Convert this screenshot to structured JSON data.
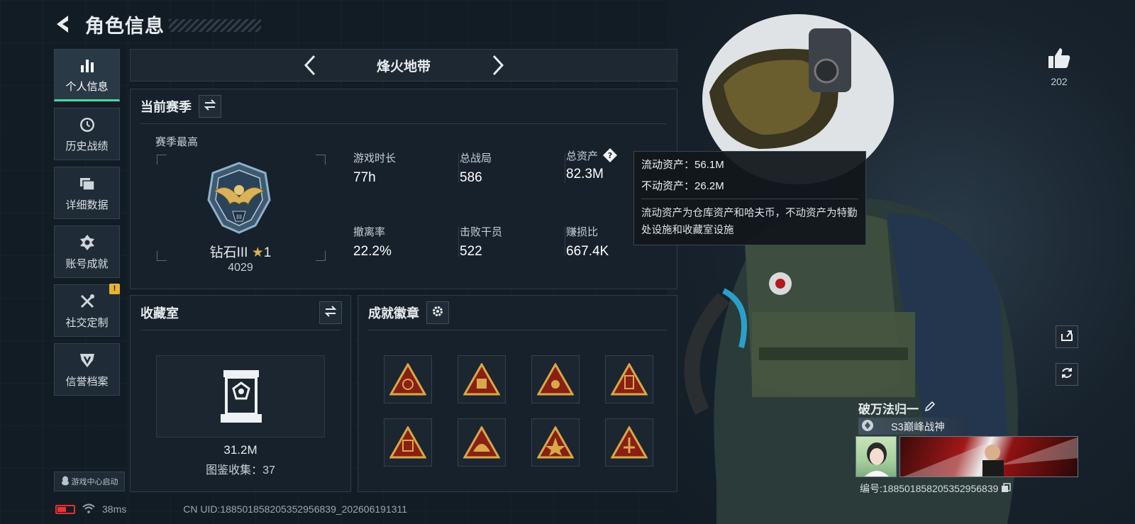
{
  "header": {
    "title": "角色信息"
  },
  "sidebar": {
    "items": [
      {
        "label": "个人信息",
        "icon": "bar-chart-icon",
        "active": true
      },
      {
        "label": "历史战绩",
        "icon": "clock-icon"
      },
      {
        "label": "详细数据",
        "icon": "folder-icon"
      },
      {
        "label": "账号成就",
        "icon": "achievement-icon"
      },
      {
        "label": "社交定制",
        "icon": "tools-icon",
        "badge": "!"
      },
      {
        "label": "信誉档案",
        "icon": "shield-icon"
      }
    ],
    "launch_label": "游戏中心启动"
  },
  "mode": {
    "title": "烽火地带"
  },
  "season": {
    "title": "当前赛季",
    "best_label": "赛季最高",
    "rank_name": "钻石III",
    "rank_stars": "1",
    "rank_score": "4029",
    "stats": [
      {
        "label": "游戏时长",
        "value": "77h"
      },
      {
        "label": "总战局",
        "value": "586"
      },
      {
        "label": "总资产",
        "value": "82.3M"
      },
      {
        "label": "撤离率",
        "value": "22.2%"
      },
      {
        "label": "击败干员",
        "value": "522"
      },
      {
        "label": "赚损比",
        "value": "667.4K"
      }
    ]
  },
  "tooltip": {
    "liquid": "流动资产：56.1M",
    "fixed": "不动资产：26.2M",
    "desc": "流动资产为仓库资产和哈夫币，不动资产为特勤处设施和收藏室设施"
  },
  "collection": {
    "title": "收藏室",
    "value": "31.2M",
    "count": "图鉴收集：37"
  },
  "badges": {
    "title": "成就徽章",
    "items": [
      "badge-1",
      "badge-2",
      "badge-3",
      "badge-4",
      "badge-5",
      "badge-6",
      "badge-7",
      "badge-8"
    ]
  },
  "likes": {
    "count": "202"
  },
  "player": {
    "name": "破万法归一",
    "title": "S3巅峰战神",
    "id": "编号:18850185820535295683​9"
  },
  "status": {
    "ping": "38ms",
    "uid": "CN UID:188501858205352956839_202606191311"
  },
  "colors": {
    "accent": "#4fd7a8",
    "badge_gold": "#d8a948",
    "badge_red": "#8a1f14",
    "warning": "#e8b430"
  }
}
